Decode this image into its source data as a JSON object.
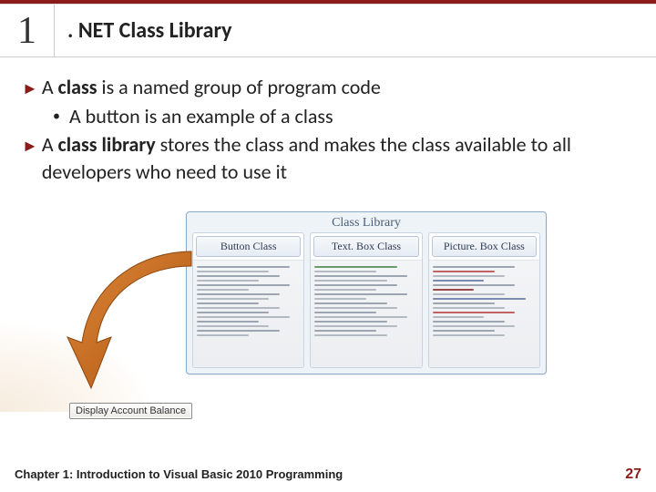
{
  "header": {
    "chapter_number": "1",
    "title": ". NET Class Library"
  },
  "bullets": {
    "b1_bold": "class",
    "b1_prefix": "A ",
    "b1_rest": " is a named group of program code",
    "b1_sub": "A button is an example of a class",
    "b2_bold": "class library",
    "b2_prefix": "A ",
    "b2_rest": " stores the class and makes the class available to all developers who need to use it"
  },
  "diagram": {
    "library_title": "Class Library",
    "col1": "Button Class",
    "col2": "Text. Box Class",
    "col3": "Picture. Box Class",
    "button_label": "Display Account Balance"
  },
  "footer": {
    "left": "Chapter 1: Introduction to Visual Basic 2010 Programming",
    "page": "27"
  }
}
